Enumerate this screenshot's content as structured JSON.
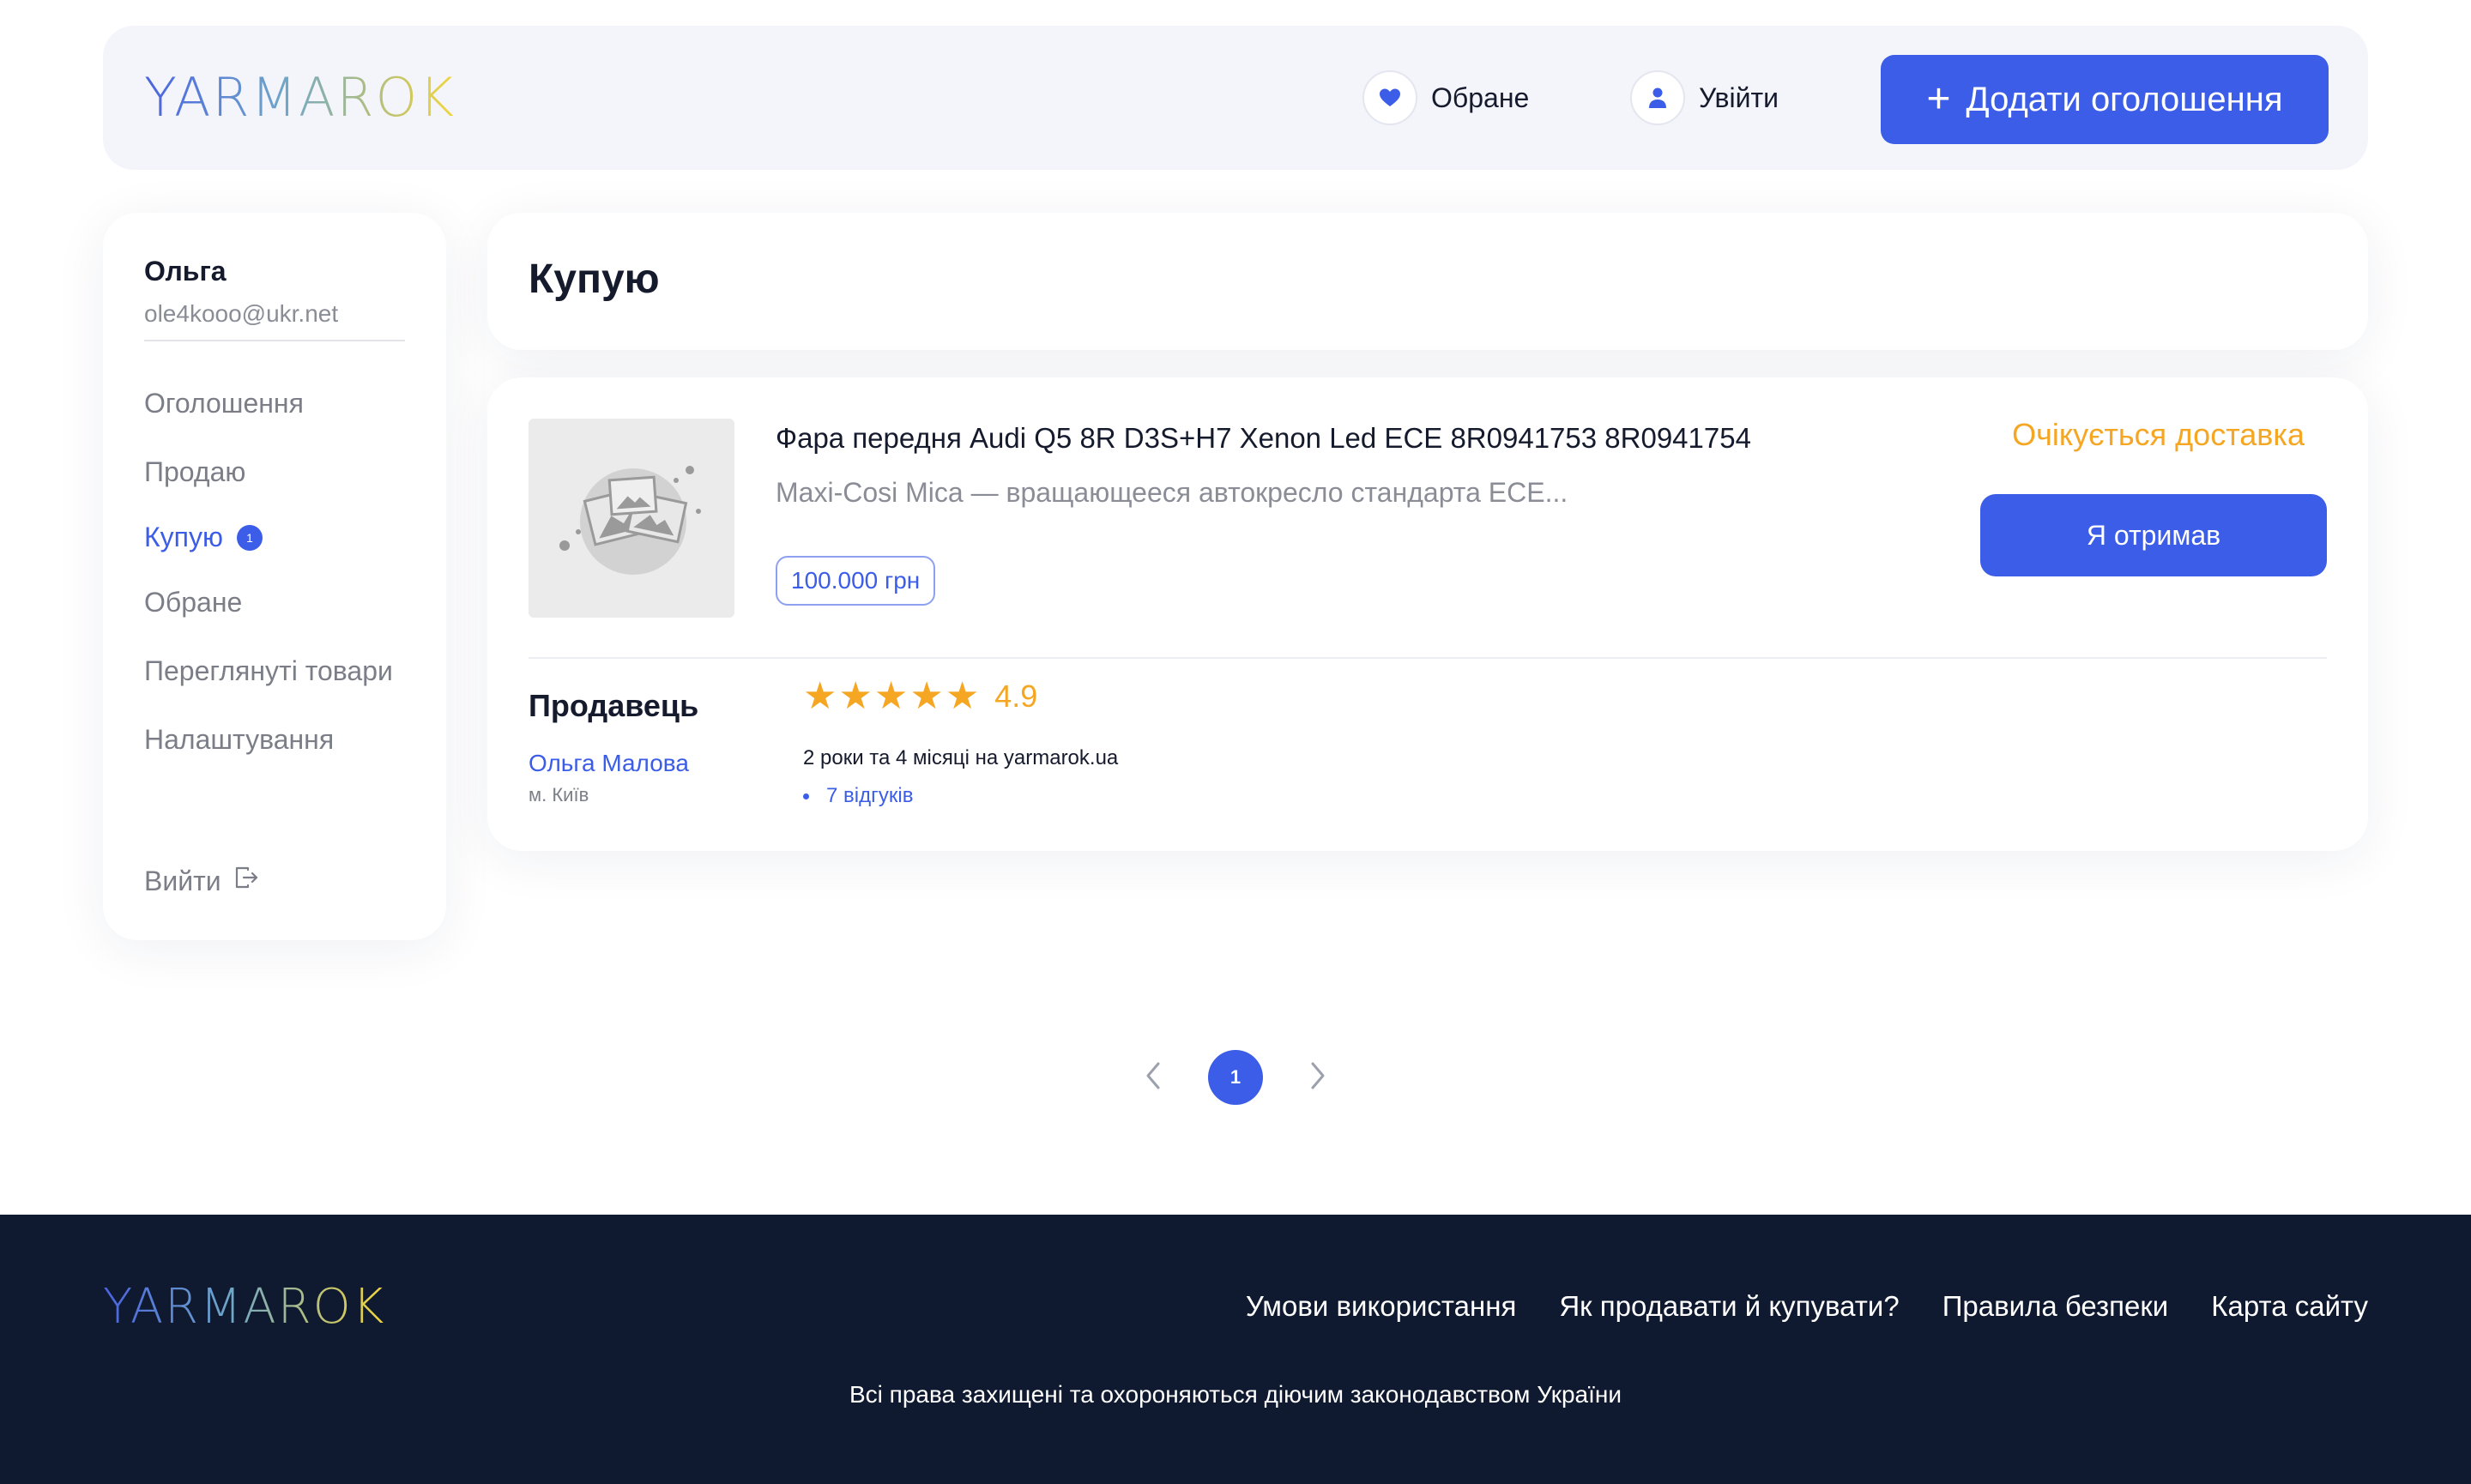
{
  "brand": {
    "logo_text": "YARMAROK",
    "colors": {
      "primary": "#3b5de7",
      "warning": "#f5a623",
      "footer_bg": "#0f1a30"
    }
  },
  "header": {
    "favorites_label": "Обране",
    "login_label": "Увійти",
    "add_listing_label": "Додати оголошення"
  },
  "sidebar": {
    "user_name": "Ольга",
    "user_email": "ole4kooo@ukr.net",
    "items": [
      {
        "label": "Оголошення"
      },
      {
        "label": "Продаю"
      },
      {
        "label": "Купую",
        "badge": "1"
      },
      {
        "label": "Обране"
      },
      {
        "label": "Переглянуті товари"
      },
      {
        "label": "Налаштування"
      }
    ],
    "logout_label": "Вийти"
  },
  "page": {
    "title": "Купую"
  },
  "order": {
    "title": "Фара передня Audi Q5 8R D3S+H7 Xenon Led ECE 8R0941753 8R0941754",
    "description": "Maxi-Cosi Mica — вращающееся автокресло стандарта ECE...",
    "price": "100.000 грн",
    "status": "Очікується доставка",
    "received_button": "Я отримав",
    "seller": {
      "heading": "Продавець",
      "name": "Ольга Малова",
      "city": "м. Київ",
      "rating": "4.9",
      "stars": 5,
      "since": "2 роки та 4 місяці на yarmarok.ua",
      "reviews": "7 відгуків"
    }
  },
  "pagination": {
    "current": "1"
  },
  "footer": {
    "links": [
      "Умови використання",
      "Як продавати й купувати?",
      "Правила безпеки",
      "Карта сайту"
    ],
    "copyright": "Всі права захищені та охороняються діючим законодавством України"
  }
}
